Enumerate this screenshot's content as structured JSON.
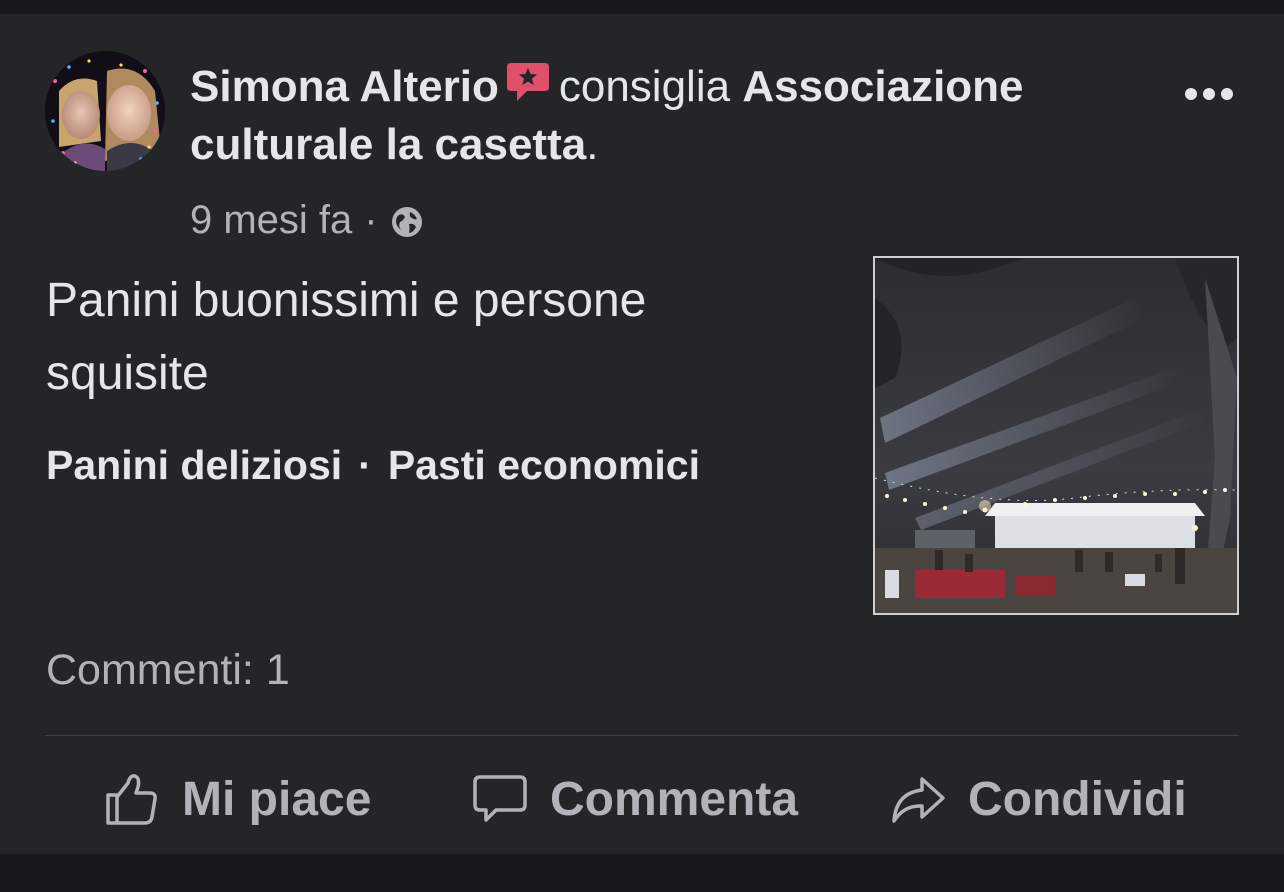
{
  "post": {
    "author": "Simona Alterio",
    "action_verb": "consiglia",
    "page_name": "Associazione culturale la casetta",
    "period": ".",
    "time": "9 mesi fa",
    "separator": "·",
    "privacy_icon": "globe-icon",
    "recommend_icon": "recommendation-star-icon",
    "text": "Panini buonissimi e persone squisite",
    "tags": [
      "Panini deliziosi",
      "Pasti economici"
    ],
    "tag_separator": "·",
    "comments_count": "Commenti: 1"
  },
  "actions": {
    "like": {
      "label": "Mi piace",
      "icon": "thumbs-up-icon"
    },
    "comment": {
      "label": "Commenta",
      "icon": "comment-bubble-icon"
    },
    "share": {
      "label": "Condividi",
      "icon": "share-arrow-icon"
    }
  },
  "colors": {
    "background": "#18191a",
    "card": "#242526",
    "text_primary": "#e4e6eb",
    "text_secondary": "#b0b3b8",
    "recommend_badge": "#e0506a"
  }
}
